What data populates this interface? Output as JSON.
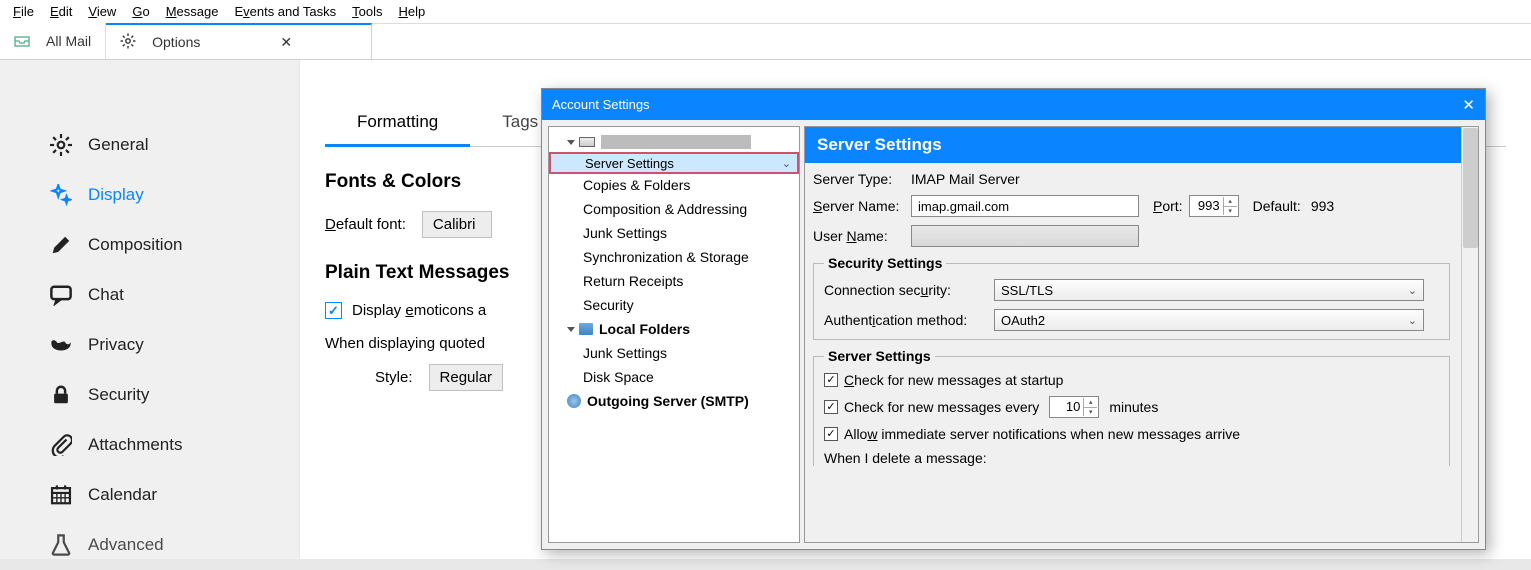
{
  "menu": [
    "File",
    "Edit",
    "View",
    "Go",
    "Message",
    "Events and Tasks",
    "Tools",
    "Help"
  ],
  "menu_accel": [
    0,
    0,
    0,
    0,
    0,
    1,
    0,
    0
  ],
  "tabs": {
    "mail": "All Mail",
    "options": "Options"
  },
  "sidebar": {
    "general": "General",
    "display": "Display",
    "composition": "Composition",
    "chat": "Chat",
    "privacy": "Privacy",
    "security": "Security",
    "attachments": "Attachments",
    "calendar": "Calendar",
    "advanced": "Advanced"
  },
  "options": {
    "tab_formatting": "Formatting",
    "tab_tags": "Tags",
    "fonts_heading": "Fonts & Colors",
    "default_font_label": "Default font:",
    "default_font_value": "Calibri",
    "plain_heading": "Plain Text Messages",
    "emoticons_label": "Display emoticons a",
    "quoted_label": "When displaying quoted",
    "style_label": "Style:",
    "style_value": "Regular"
  },
  "modal": {
    "title": "Account Settings",
    "tree": {
      "server_settings": "Server Settings",
      "copies": "Copies & Folders",
      "composition": "Composition & Addressing",
      "junk": "Junk Settings",
      "sync": "Synchronization & Storage",
      "receipts": "Return Receipts",
      "security": "Security",
      "local_folders": "Local Folders",
      "junk2": "Junk Settings",
      "disk": "Disk Space",
      "smtp": "Outgoing Server (SMTP)"
    },
    "panel": {
      "heading": "Server Settings",
      "server_type_label": "Server Type:",
      "server_type_value": "IMAP Mail Server",
      "server_name_label": "Server Name:",
      "server_name_value": "imap.gmail.com",
      "port_label": "Port:",
      "port_value": "993",
      "default_label": "Default:",
      "default_value": "993",
      "user_label": "User Name:",
      "user_value": "",
      "sec_heading": "Security Settings",
      "conn_label": "Connection security:",
      "conn_value": "SSL/TLS",
      "auth_label": "Authentication method:",
      "auth_value": "OAuth2",
      "srv_heading": "Server Settings",
      "chk_startup": "Check for new messages at startup",
      "chk_every": "Check for new messages every",
      "chk_every_val": "10",
      "chk_every_unit": "minutes",
      "chk_allow": "Allow immediate server notifications when new messages arrive",
      "delete_label": "When I delete a message:"
    }
  }
}
